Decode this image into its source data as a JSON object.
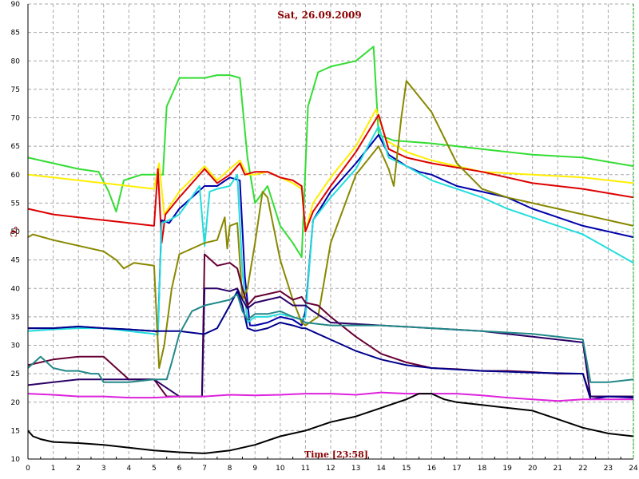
{
  "chart_data": {
    "type": "line",
    "title": "Sat, 26.09.2009",
    "xlabel": "Time [23:58]",
    "ylabel": "°C",
    "xlim": [
      0,
      24
    ],
    "ylim": [
      10,
      90
    ],
    "xticks": [
      0,
      1,
      2,
      3,
      4,
      5,
      6,
      7,
      8,
      9,
      10,
      11,
      12,
      13,
      14,
      15,
      16,
      17,
      18,
      19,
      20,
      21,
      22,
      23,
      24
    ],
    "yticks": [
      10,
      15,
      20,
      25,
      30,
      35,
      40,
      45,
      50,
      55,
      60,
      65,
      70,
      75,
      80,
      85,
      90
    ],
    "grid": true,
    "legend": "none",
    "series": [
      {
        "color": "#33dd33",
        "x": [
          0,
          1,
          2,
          2.8,
          3.2,
          3.5,
          3.8,
          4.5,
          5.2,
          5.35,
          5.5,
          6,
          7,
          7.5,
          8,
          8.4,
          8.7,
          9,
          9.5,
          10,
          10.5,
          10.85,
          11.1,
          11.5,
          12,
          13,
          13.7,
          13.9,
          14.5,
          16,
          18,
          20,
          22,
          24
        ],
        "y": [
          63,
          62,
          61,
          60.5,
          57,
          53.5,
          59,
          60,
          60,
          60,
          72,
          77,
          77,
          77.5,
          77.5,
          77,
          63,
          55,
          58,
          51,
          48,
          45.5,
          72,
          78,
          79,
          80,
          82.5,
          67,
          66,
          65.5,
          64.5,
          63.5,
          63,
          61.5
        ]
      },
      {
        "color": "#ffee00",
        "x": [
          0,
          1,
          2,
          3,
          4,
          5,
          5.2,
          5.4,
          6,
          7,
          7.5,
          8,
          8.4,
          8.7,
          9,
          9.5,
          10,
          10.5,
          10.85,
          11,
          11.3,
          12,
          13,
          13.8,
          14.2,
          15,
          16,
          18,
          20,
          22,
          24
        ],
        "y": [
          60,
          59.5,
          59,
          58.5,
          58,
          57.5,
          62,
          53,
          57,
          61.5,
          59,
          61,
          62.5,
          60,
          60,
          60.5,
          59.5,
          58.5,
          57.5,
          50,
          55,
          59.5,
          65,
          71.5,
          66,
          64,
          62.5,
          60.5,
          60,
          59.5,
          58.5
        ]
      },
      {
        "color": "#dd0000",
        "x": [
          0,
          1,
          2,
          3,
          4,
          5,
          5.15,
          5.3,
          5.45,
          6,
          7,
          7.5,
          8,
          8.4,
          8.6,
          9,
          9.5,
          10,
          10.5,
          10.85,
          11,
          11.3,
          12,
          13,
          13.9,
          14.3,
          15,
          16,
          18,
          20,
          22,
          24
        ],
        "y": [
          54,
          53,
          52.5,
          52,
          51.5,
          51,
          61,
          48,
          53,
          56,
          61,
          58.5,
          60,
          62,
          60,
          60.5,
          60.5,
          59.5,
          59,
          58,
          50,
          53.5,
          58,
          64,
          70.5,
          64.5,
          63,
          62,
          60.5,
          58.5,
          57.5,
          56
        ]
      },
      {
        "color": "#0000aa",
        "x": [
          0,
          1,
          2,
          3,
          4,
          5,
          5.15,
          5.3,
          5.6,
          6,
          7,
          7.5,
          8,
          8.4,
          8.6,
          8.8,
          9,
          9.5,
          10,
          10.5,
          10.85,
          11,
          11.3,
          12,
          13,
          13.9,
          14.3,
          15,
          15.5,
          16,
          17,
          18,
          19,
          20,
          21,
          22,
          23,
          24
        ],
        "y": [
          33,
          33,
          33.3,
          33,
          32.8,
          32.5,
          32.3,
          52,
          51.5,
          54,
          58,
          58,
          59.5,
          59,
          42,
          33.5,
          33.5,
          34,
          35,
          34.5,
          33.5,
          36,
          52,
          57,
          62,
          67,
          63.5,
          61.5,
          60.5,
          60,
          58,
          57,
          56,
          54,
          52.5,
          51,
          50,
          49
        ]
      },
      {
        "color": "#22dddd",
        "x": [
          0,
          1,
          2,
          3,
          4,
          5,
          5.15,
          5.3,
          5.6,
          6,
          6.8,
          7,
          7.2,
          7.5,
          8,
          8.3,
          8.5,
          8.7,
          9,
          9.5,
          10,
          10.5,
          10.85,
          11,
          11.3,
          12,
          13,
          13.9,
          14.3,
          15,
          16,
          17,
          18,
          19,
          20,
          21,
          22,
          23,
          24
        ],
        "y": [
          32.5,
          32.8,
          33,
          33,
          32.5,
          32,
          31.8,
          51.5,
          52,
          53,
          58,
          47.5,
          57,
          57.5,
          58,
          60,
          43,
          34,
          35,
          35,
          35.5,
          35,
          34.5,
          35,
          52,
          56,
          61,
          68.5,
          63,
          61.5,
          59,
          57.5,
          56,
          54,
          52.5,
          51,
          49.5,
          47,
          44.5
        ]
      },
      {
        "color": "#888800",
        "x": [
          0,
          0.2,
          1,
          2,
          3,
          3.5,
          3.8,
          4.2,
          5,
          5.2,
          5.4,
          5.7,
          6,
          7,
          7.5,
          7.8,
          7.9,
          8,
          8.3,
          8.5,
          8.7,
          9,
          9.3,
          9.5,
          10,
          10.5,
          10.85,
          11,
          11.5,
          12,
          13,
          13.9,
          14.3,
          14.5,
          14.8,
          15,
          16,
          17,
          18,
          19,
          20,
          21,
          22,
          23,
          24
        ],
        "y": [
          49,
          49.5,
          48.5,
          47.5,
          46.5,
          45,
          43.5,
          44.5,
          44,
          26,
          30,
          40,
          46,
          48,
          48.5,
          52.5,
          47,
          51,
          51.5,
          38,
          40,
          48,
          57,
          56,
          45,
          38,
          34,
          33.5,
          35,
          48,
          60,
          65,
          61,
          58,
          70,
          76.5,
          71,
          62,
          57.5,
          56,
          55,
          54,
          53,
          52,
          51
        ]
      },
      {
        "color": "#660033",
        "x": [
          0,
          1,
          2,
          3,
          4,
          5,
          5.5,
          6,
          6.8,
          6.9,
          7,
          7.5,
          8,
          8.3,
          8.5,
          8.7,
          9,
          9.5,
          10,
          10.5,
          10.85,
          11,
          11.5,
          12,
          13,
          14,
          15,
          16,
          17,
          18,
          19,
          20,
          21,
          22,
          22.3,
          23,
          24
        ],
        "y": [
          26.5,
          27.5,
          28,
          28,
          24,
          24,
          21,
          21,
          21,
          21,
          46,
          44,
          44.5,
          43.5,
          40,
          37,
          38.5,
          39,
          39.5,
          38,
          38.5,
          37.5,
          37,
          35,
          31.5,
          28.5,
          27,
          26,
          25.8,
          25.5,
          25.5,
          25.3,
          25,
          25,
          21,
          21,
          21
        ]
      },
      {
        "color": "#2b0066",
        "x": [
          0,
          1,
          2,
          3,
          4,
          5,
          6,
          6.9,
          7,
          7.5,
          8,
          8.3,
          8.5,
          8.7,
          9,
          9.5,
          10,
          10.5,
          10.85,
          11,
          11.3,
          12,
          14,
          16,
          18,
          20,
          22,
          22.3,
          23,
          24
        ],
        "y": [
          23,
          23.5,
          24,
          24,
          24,
          24,
          21,
          21,
          40,
          40,
          39.5,
          40,
          38,
          36.5,
          37.5,
          38,
          38.5,
          37,
          37,
          37,
          36,
          34,
          33.5,
          33,
          32.5,
          31.5,
          30.5,
          21,
          21,
          21
        ]
      },
      {
        "color": "#00008b",
        "x": [
          0,
          1,
          2,
          3,
          4,
          5,
          6,
          6.9,
          7,
          7.5,
          8,
          8.3,
          8.5,
          8.7,
          9,
          9.5,
          10,
          10.5,
          10.85,
          11,
          11.5,
          12,
          13,
          14,
          15,
          16,
          18,
          20,
          22,
          22.3,
          23,
          24
        ],
        "y": [
          33,
          33,
          33.3,
          33,
          32.8,
          32.5,
          32.5,
          32,
          32,
          33,
          37,
          39.5,
          37,
          33,
          32.5,
          33,
          34,
          33.5,
          33,
          33,
          32,
          31,
          29,
          27.5,
          26.5,
          26,
          25.5,
          25.2,
          25,
          20.5,
          21,
          20.8
        ]
      },
      {
        "color": "#228888",
        "x": [
          0,
          0.5,
          1,
          1.5,
          2,
          2.5,
          2.8,
          3,
          4,
          5,
          5.5,
          5.7,
          6,
          6.5,
          7,
          7.5,
          8,
          8.3,
          8.5,
          8.7,
          9,
          9.5,
          10,
          10.5,
          10.85,
          11,
          12,
          14,
          16,
          18,
          20,
          22,
          22.3,
          23,
          24
        ],
        "y": [
          26,
          28,
          26,
          25.5,
          25.5,
          25,
          25,
          23.5,
          23.5,
          24,
          24,
          27,
          32,
          36,
          37,
          37.5,
          38,
          39,
          36,
          34.5,
          35.5,
          35.5,
          36,
          35,
          34.5,
          34,
          33.5,
          33.5,
          33,
          32.5,
          32,
          31,
          23.5,
          23.5,
          24
        ]
      },
      {
        "color": "#dd22dd",
        "x": [
          0,
          1,
          2,
          3,
          4,
          5,
          6,
          7,
          8,
          9,
          10,
          11,
          12,
          13,
          14,
          15,
          16,
          17,
          18,
          19,
          20,
          21,
          22,
          23,
          24
        ],
        "y": [
          21.5,
          21.3,
          21,
          21,
          20.8,
          20.8,
          21,
          21,
          21.3,
          21.2,
          21.3,
          21.5,
          21.5,
          21.3,
          21.7,
          21.5,
          21.5,
          21.5,
          21.2,
          20.8,
          20.5,
          20.2,
          20.5,
          20.5,
          20.5
        ]
      },
      {
        "color": "#000000",
        "x": [
          0,
          0.2,
          0.5,
          1,
          2,
          3,
          4,
          5,
          6,
          7,
          8,
          9,
          10,
          11,
          12,
          13,
          14,
          15,
          15.5,
          16,
          16.5,
          17,
          18,
          19,
          20,
          21,
          22,
          23,
          24
        ],
        "y": [
          15,
          14,
          13.5,
          13,
          12.8,
          12.5,
          12,
          11.5,
          11.2,
          11,
          11.5,
          12.5,
          14,
          15,
          16.5,
          17.5,
          19,
          20.5,
          21.5,
          21.5,
          20.5,
          20,
          19.5,
          19,
          18.5,
          17,
          15.5,
          14.5,
          14
        ]
      }
    ]
  }
}
